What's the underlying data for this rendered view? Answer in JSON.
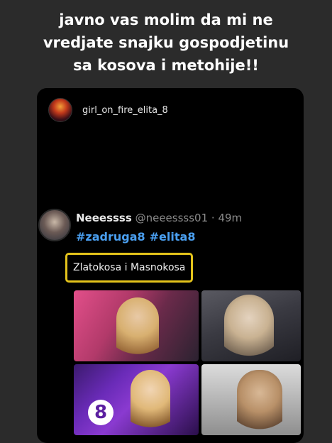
{
  "caption": {
    "line1": "javno vas molim da mi ne",
    "line2": "vredjate snajku gospodjetinu",
    "line3": "sa kosova i metohije!!"
  },
  "story": {
    "username": "girl_on_fire_elita_8"
  },
  "tweet": {
    "display_name": "Neeessss",
    "handle": "@neeessss01",
    "separator": "·",
    "time": "49m",
    "hashtag1": "#zadruga8",
    "hashtag2": "#elita8",
    "text": "Zlatokosa i Masnokosa"
  },
  "images": {
    "logo_text": "8"
  },
  "colors": {
    "background": "#2b2b2b",
    "card": "#000000",
    "hashtag": "#4a9ff0",
    "highlight_border": "#e3c31b"
  }
}
